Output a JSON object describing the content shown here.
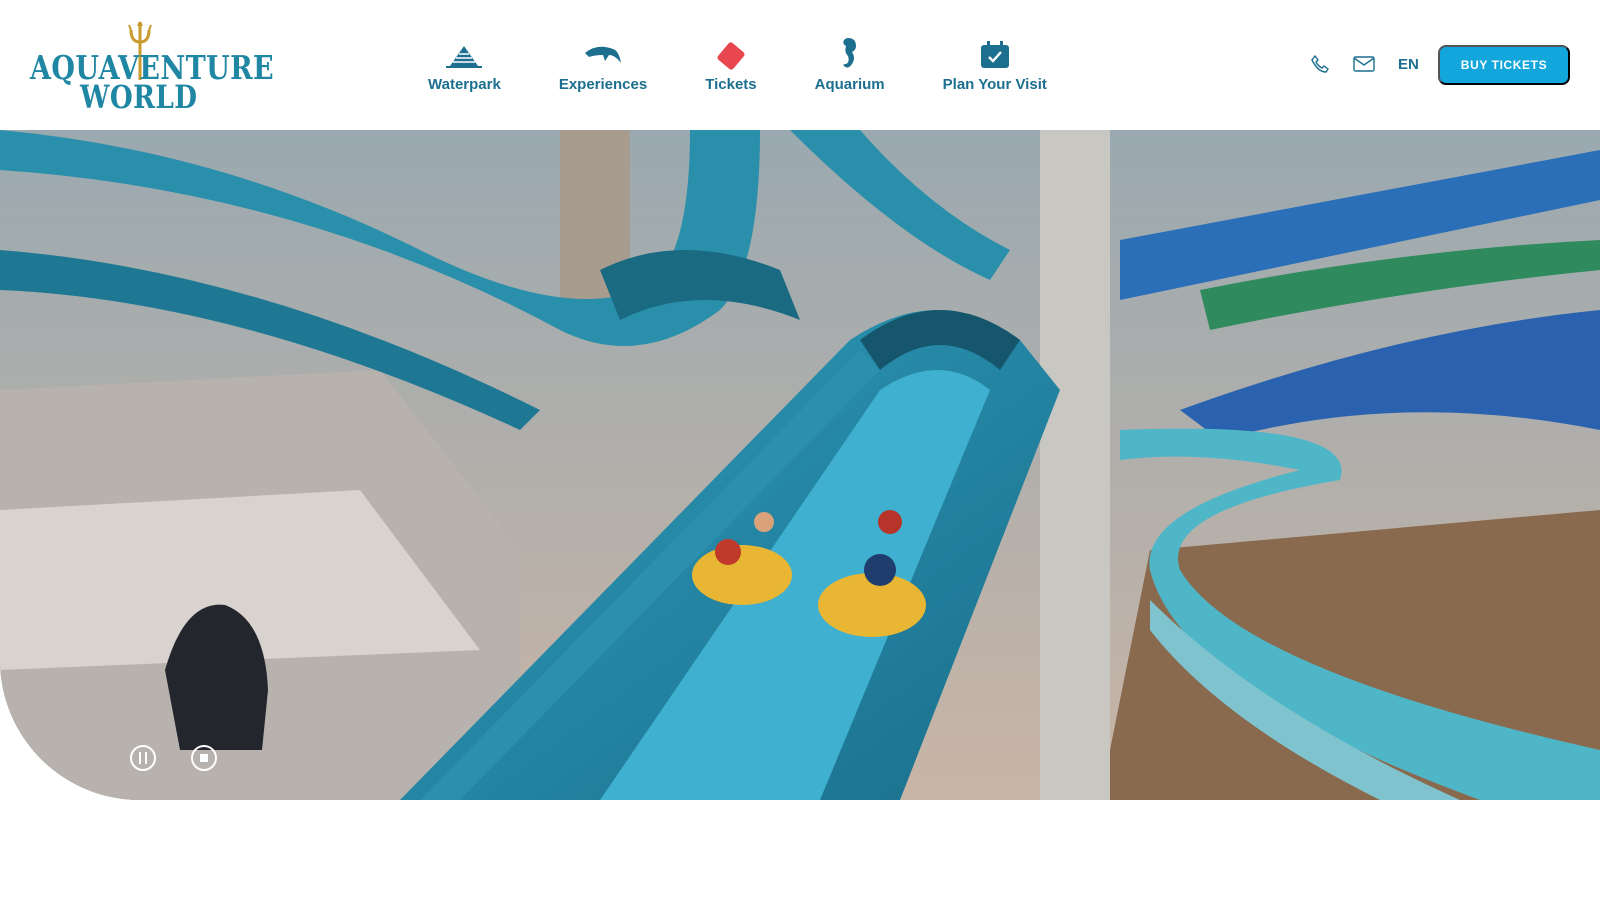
{
  "brand": {
    "logo_line1": "AQUAVENTURE",
    "logo_line2": "WORLD"
  },
  "nav": {
    "items": [
      {
        "label": "Waterpark",
        "icon": "waterpark-pyramid-icon"
      },
      {
        "label": "Experiences",
        "icon": "dolphin-icon"
      },
      {
        "label": "Tickets",
        "icon": "ticket-icon"
      },
      {
        "label": "Aquarium",
        "icon": "seahorse-icon"
      },
      {
        "label": "Plan Your Visit",
        "icon": "calendar-check-icon"
      }
    ]
  },
  "utilities": {
    "phone_icon": "phone-icon",
    "mail_icon": "mail-icon",
    "language": "EN"
  },
  "cta": {
    "buy_tickets": "BUY TICKETS"
  },
  "hero": {
    "media": "video of riders on yellow tubes going down a blue water slide",
    "controls": {
      "pause_icon": "pause-icon",
      "stop_icon": "stop-icon"
    }
  },
  "colors": {
    "accent": "#12a6dd",
    "nav_text": "#1c6f8f",
    "logo": "#1f86a3",
    "ticket_red": "#e8474f"
  }
}
